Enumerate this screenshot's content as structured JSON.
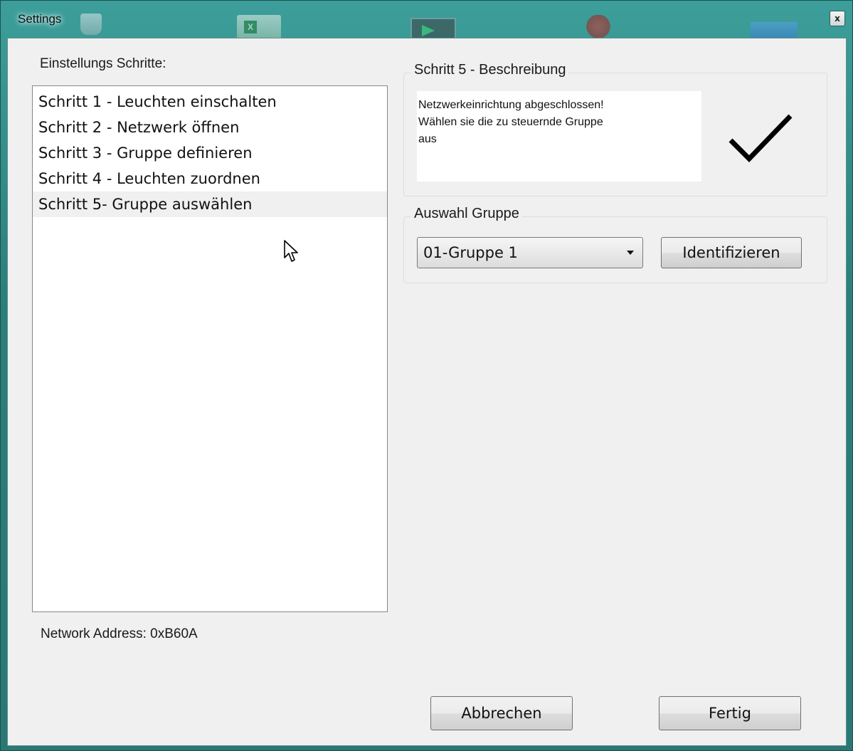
{
  "window": {
    "title": "Settings",
    "close_label": "x"
  },
  "desktop_icons": [
    "recycle-bin-icon",
    "excel-icon",
    "terminal-icon",
    "ladybug-icon",
    "window-icon"
  ],
  "steps": {
    "label": "Einstellungs Schritte:",
    "items": [
      {
        "label": "Schritt 1 - Leuchten einschalten",
        "selected": false
      },
      {
        "label": "Schritt 2 - Netzwerk öffnen",
        "selected": false
      },
      {
        "label": "Schritt 3 - Gruppe definieren",
        "selected": false
      },
      {
        "label": "Schritt 4 - Leuchten zuordnen",
        "selected": false
      },
      {
        "label": "Schritt 5- Gruppe auswählen",
        "selected": true
      }
    ]
  },
  "network_address": "Network Address: 0xB60A",
  "description": {
    "title": "Schritt 5 - Beschreibung",
    "line1": "Netzwerkeinrichtung abgeschlossen!",
    "line2": "Wählen sie die zu steuernde Gruppe",
    "line3": "aus",
    "icon": "checkmark-icon"
  },
  "group_select": {
    "title": "Auswahl Gruppe",
    "selected_value": "01-Gruppe 1",
    "identify_label": "Identifizieren"
  },
  "footer": {
    "cancel_label": "Abbrechen",
    "finish_label": "Fertig"
  },
  "colors": {
    "frame": "#2f8a85",
    "client_bg": "#f0f0f0",
    "list_bg": "#ffffff"
  }
}
